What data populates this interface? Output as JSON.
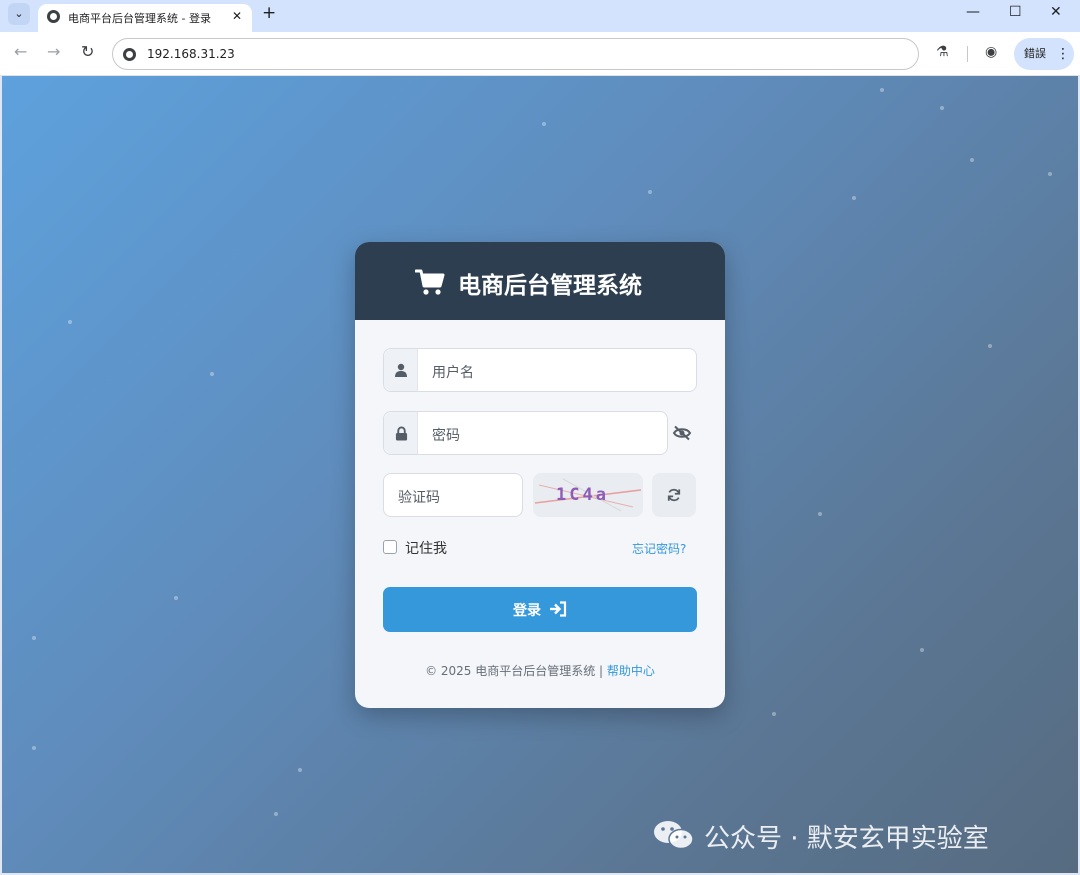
{
  "browser": {
    "tab_title": "电商平台后台管理系统 - 登录",
    "tab_close": "✕",
    "new_tab": "+",
    "url": "192.168.31.23",
    "profile_label": "錯誤",
    "menu_dots": "⋮"
  },
  "login": {
    "title": "电商后台管理系统",
    "username_placeholder": "用户名",
    "password_placeholder": "密码",
    "captcha_placeholder": "验证码",
    "captcha_text": "1C4a",
    "remember_label": "记住我",
    "forgot_link": "忘记密码?",
    "login_button": "登录",
    "footer_text": "© 2025 电商平台后台管理系统 | ",
    "help_link": "帮助中心"
  },
  "watermark": {
    "text": "公众号 · 默安玄甲实验室"
  },
  "colors": {
    "header": "#2c3e50",
    "accent": "#3498db",
    "card_bg": "#f4f6f9"
  },
  "icons": [
    "cart-icon",
    "user-icon",
    "lock-icon",
    "eye-slash-icon",
    "refresh-icon",
    "sign-in-icon",
    "wechat-icon"
  ]
}
